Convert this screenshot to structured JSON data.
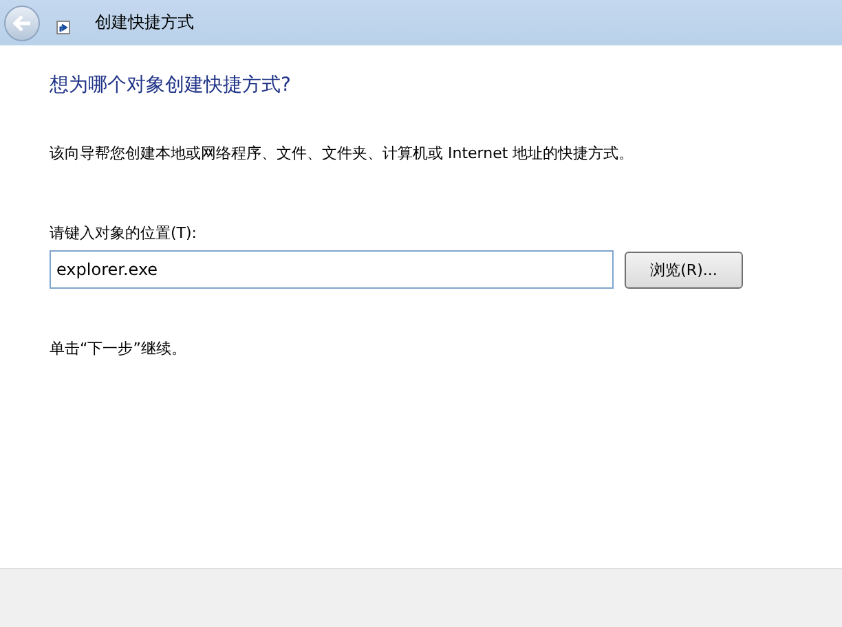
{
  "window": {
    "title": "创建快捷方式"
  },
  "heading": "想为哪个对象创建快捷方式?",
  "description": "该向导帮您创建本地或网络程序、文件、文件夹、计算机或 Internet 地址的快捷方式。",
  "location": {
    "label": "请键入对象的位置(T):",
    "value": "explorer.exe",
    "browse_button": "浏览(R)..."
  },
  "hint": "单击“下一步”继续。"
}
